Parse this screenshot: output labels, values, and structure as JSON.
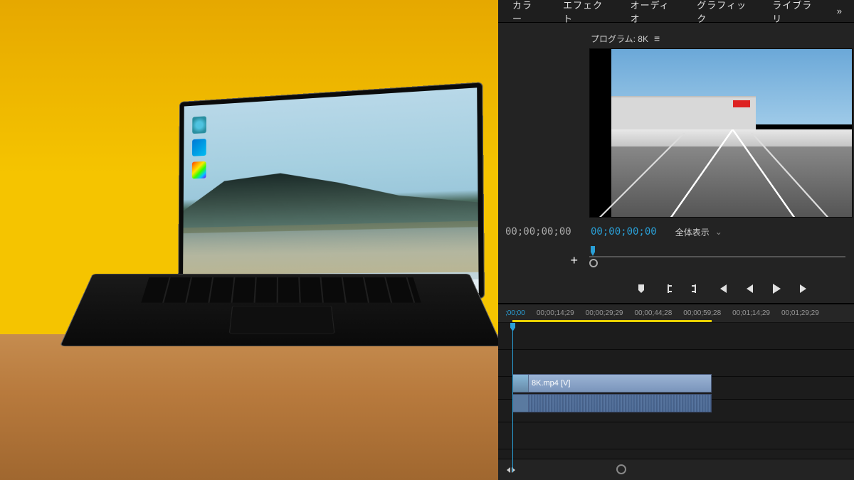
{
  "tabs": {
    "color": "カラー",
    "effects": "エフェクト",
    "audio": "オーディオ",
    "graphics": "グラフィック",
    "library": "ライブラリ",
    "more": "»"
  },
  "program": {
    "label": "プログラム: 8K",
    "menu": "≡",
    "timecode_left": "00;00;00;00",
    "timecode_right": "00;00;00;00",
    "fit_label": "全体表示"
  },
  "transport": {
    "plus": "+"
  },
  "timeline": {
    "ruler": [
      ";00;00",
      "00;00;14;29",
      "00;00;29;29",
      "00;00;44;28",
      "00;00;59;28",
      "00;01;14;29",
      "00;01;29;29"
    ],
    "clip_label": "8K.mp4 [V]"
  }
}
